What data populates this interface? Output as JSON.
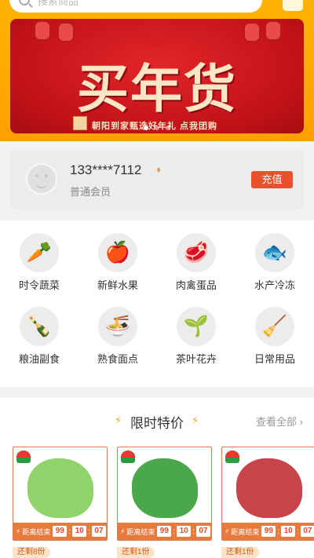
{
  "search": {
    "placeholder": "搜索商品"
  },
  "banner": {
    "title": "买年货",
    "subtitle": "朝阳到家甄选好年礼 点我团购",
    "active_slide": 0,
    "slide_count": 3
  },
  "member": {
    "phone": "133****7112",
    "level": "普通会员",
    "recharge_label": "充值"
  },
  "categories": [
    {
      "label": "时令蔬菜",
      "icon": "carrot-icon",
      "glyph": "🥕"
    },
    {
      "label": "新鲜水果",
      "icon": "apple-icon",
      "glyph": "🍎"
    },
    {
      "label": "肉禽蛋品",
      "icon": "meat-icon",
      "glyph": "🥩"
    },
    {
      "label": "水产冷冻",
      "icon": "fish-icon",
      "glyph": "🐟"
    },
    {
      "label": "粮油副食",
      "icon": "oil-bottle-icon",
      "glyph": "🍾"
    },
    {
      "label": "熟食面点",
      "icon": "noodle-bowl-icon",
      "glyph": "🍜"
    },
    {
      "label": "茶叶花卉",
      "icon": "potted-plant-icon",
      "glyph": "🌱"
    },
    {
      "label": "日常用品",
      "icon": "broom-icon",
      "glyph": "🧹"
    }
  ],
  "flash_sale": {
    "title": "限时特价",
    "more_label": "查看全部",
    "products": [
      {
        "image": "lettuce-image",
        "countdown_label": "距离结束",
        "h": "99",
        "m": "10",
        "s": "07",
        "stock": "还剩8份",
        "color": "#8fd36a"
      },
      {
        "image": "green-onion-image",
        "countdown_label": "距离结束",
        "h": "99",
        "m": "10",
        "s": "07",
        "stock": "还剩1份",
        "color": "#4aa84a"
      },
      {
        "image": "pork-image",
        "countdown_label": "距离结束",
        "h": "99",
        "m": "10",
        "s": "07",
        "stock": "还剩1份",
        "color": "#c9434b"
      }
    ]
  },
  "colors": {
    "brand_orange": "#ffa000",
    "accent_red": "#e8512c",
    "banner_red": "#c11217"
  }
}
